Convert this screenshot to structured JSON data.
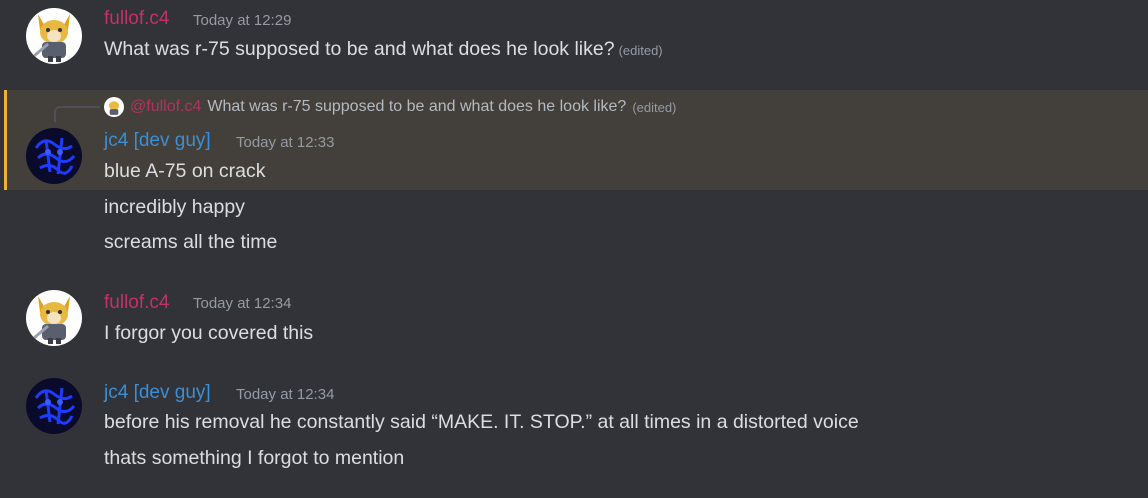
{
  "messages": [
    {
      "username": "fullof.c4",
      "timestamp": "Today at 12:29",
      "lines": [
        "What was r-75 supposed to be and what does he look like?"
      ],
      "edited_label": "(edited)"
    },
    {
      "reply": {
        "username": "@fullof.c4",
        "text": "What was r-75 supposed to be and what does he look like?",
        "edited_label": "(edited)"
      },
      "username": "jc4 [dev guy]",
      "timestamp": "Today at 12:33",
      "lines": [
        "blue A-75 on crack",
        "incredibly happy",
        "screams all the time"
      ]
    },
    {
      "username": "fullof.c4",
      "timestamp": "Today at 12:34",
      "lines": [
        "I forgor you covered this"
      ]
    },
    {
      "username": "jc4 [dev guy]",
      "timestamp": "Today at 12:34",
      "lines": [
        "before his removal he constantly said “MAKE. IT. STOP.” at all times in a distorted voice",
        "thats something I forgot to mention"
      ]
    }
  ],
  "icons": {
    "fullof_avatar": "fox-character-avatar",
    "jc4_avatar": "blue-scribble-avatar"
  },
  "colors": {
    "background": "#313338",
    "fullof_name": "#c4316a",
    "jc4_name": "#3b8fd6",
    "highlight": "#433f3a",
    "highlight_bar": "#f0b232"
  }
}
